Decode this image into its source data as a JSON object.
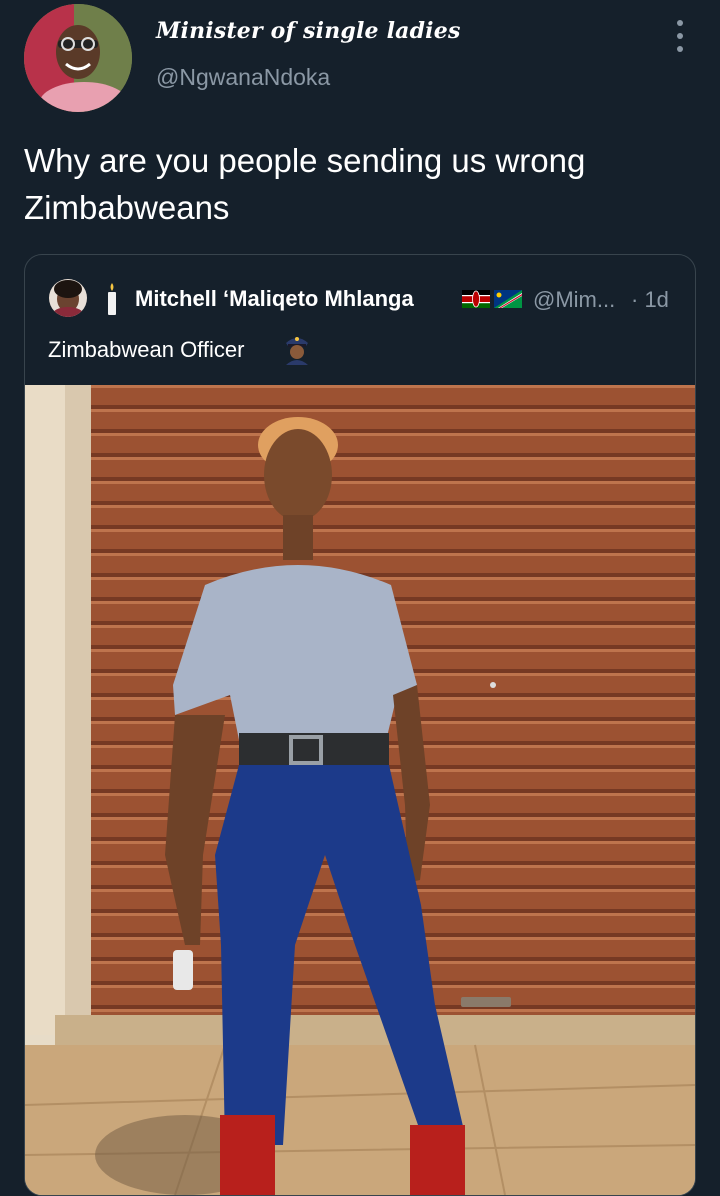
{
  "tweet": {
    "author_name": "Minister of single ladies",
    "author_handle": "@NgwanaNdoka",
    "text": "Why are you people sending us wrong Zimbabweans",
    "more_icon": "three-dots-vertical-icon"
  },
  "quoted_tweet": {
    "author_name": "Mitchell ‘Maliqeto Mhlanga",
    "author_handle": "@Mim...",
    "time": "· 1d",
    "text": "Zimbabwean Officer",
    "name_prefix_icon": "candle-icon",
    "flags": [
      "kenya-flag",
      "namibia-flag"
    ],
    "text_emoji": "police-officer-emoji",
    "photo_description_icon": "photo-image"
  },
  "colors": {
    "background": "#15202b",
    "border": "#38444d",
    "secondary_text": "#8b98a5",
    "primary_text": "#ffffff"
  }
}
